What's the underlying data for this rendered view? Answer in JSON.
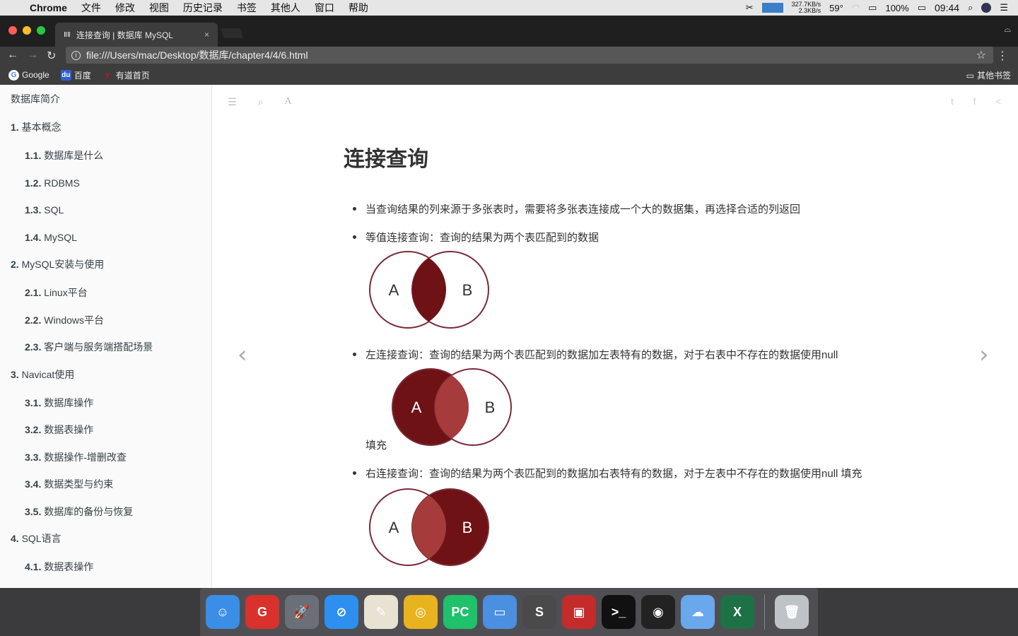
{
  "menubar": {
    "apple": "",
    "app": "Chrome",
    "items": [
      "文件",
      "修改",
      "视图",
      "历史记录",
      "书签",
      "其他人",
      "窗口",
      "帮助"
    ],
    "net_up": "327.7KB/s",
    "net_down": "2.3KB/s",
    "temp": "59°",
    "battery": "100%",
    "time": "09:44"
  },
  "tab": {
    "favicon": "ⅡⅡ",
    "title": "连接查询 | 数据库 MySQL",
    "close": "×"
  },
  "toolbar": {
    "url": "file:///Users/mac/Desktop/数据库/chapter4/4/6.html"
  },
  "bookmarks": [
    {
      "label": "Google",
      "icon": "G",
      "color": "#4285f4"
    },
    {
      "label": "百度",
      "icon": "du",
      "color": "#2f5fd3"
    },
    {
      "label": "有道首页",
      "icon": "y",
      "color": "#d0121b"
    }
  ],
  "other_bookmarks": "其他书签",
  "sidebar": [
    {
      "num": "",
      "label": "数据库简介",
      "level": 0
    },
    {
      "num": "1.",
      "label": "基本概念",
      "level": 0
    },
    {
      "num": "1.1.",
      "label": "数据库是什么",
      "level": 1
    },
    {
      "num": "1.2.",
      "label": "RDBMS",
      "level": 1
    },
    {
      "num": "1.3.",
      "label": "SQL",
      "level": 1
    },
    {
      "num": "1.4.",
      "label": "MySQL",
      "level": 1
    },
    {
      "num": "2.",
      "label": "MySQL安装与使用",
      "level": 0
    },
    {
      "num": "2.1.",
      "label": "Linux平台",
      "level": 1
    },
    {
      "num": "2.2.",
      "label": "Windows平台",
      "level": 1
    },
    {
      "num": "2.3.",
      "label": "客户端与服务端搭配场景",
      "level": 1
    },
    {
      "num": "3.",
      "label": "Navicat使用",
      "level": 0
    },
    {
      "num": "3.1.",
      "label": "数据库操作",
      "level": 1
    },
    {
      "num": "3.2.",
      "label": "数据表操作",
      "level": 1
    },
    {
      "num": "3.3.",
      "label": "数据操作-增删改查",
      "level": 1
    },
    {
      "num": "3.4.",
      "label": "数据类型与约束",
      "level": 1
    },
    {
      "num": "3.5.",
      "label": "数据库的备份与恢复",
      "level": 1
    },
    {
      "num": "4.",
      "label": "SQL语言",
      "level": 0
    },
    {
      "num": "4.1.",
      "label": "数据表操作",
      "level": 1
    }
  ],
  "content": {
    "title": "连接查询",
    "items": [
      {
        "text": "当查询结果的列来源于多张表时，需要将多张表连接成一个大的数据集，再选择合适的列返回"
      },
      {
        "text": "等值连接查询：查询的结果为两个表匹配到的数据",
        "venn": "inner"
      },
      {
        "text": "左连接查询：查询的结果为两个表匹配到的数据加左表特有的数据，对于右表中不存在的数据使用null",
        "venn": "left",
        "after": "填充"
      },
      {
        "text": "右连接查询：查询的结果为两个表匹配到的数据加右表特有的数据，对于左表中不存在的数据使用null 填充",
        "venn": "right"
      }
    ],
    "venn_labels": {
      "a": "A",
      "b": "B"
    },
    "colors": {
      "dark": "#6e1216",
      "mid": "#a53b3b",
      "outline": "#7a2b36"
    }
  },
  "dock": [
    {
      "name": "Finder",
      "color": "#3a8ee6",
      "glyph": "☺"
    },
    {
      "name": "Git",
      "color": "#d9312b",
      "glyph": "G"
    },
    {
      "name": "Launchpad",
      "color": "#6b6f78",
      "glyph": "🚀"
    },
    {
      "name": "Safari",
      "color": "#2d8ff0",
      "glyph": "⊘"
    },
    {
      "name": "Preview",
      "color": "#e8e2d2",
      "glyph": "✎"
    },
    {
      "name": "Chrome",
      "color": "#e9b21f",
      "glyph": "◎"
    },
    {
      "name": "PyCharm",
      "color": "#1fc16b",
      "glyph": "PC"
    },
    {
      "name": "Keynote",
      "color": "#4b8fe0",
      "glyph": "▭"
    },
    {
      "name": "Sublime",
      "color": "#4a4a4a",
      "glyph": "S"
    },
    {
      "name": "Parallels",
      "color": "#c42b2b",
      "glyph": "▣"
    },
    {
      "name": "Terminal",
      "color": "#111",
      "glyph": ">_"
    },
    {
      "name": "OBS",
      "color": "#222",
      "glyph": "◉"
    },
    {
      "name": "Cloud",
      "color": "#6aa8ee",
      "glyph": "☁"
    },
    {
      "name": "Excel",
      "color": "#1e7145",
      "glyph": "X"
    },
    {
      "name": "Trash",
      "color": "#bfc3c8",
      "glyph": "🗑"
    }
  ]
}
